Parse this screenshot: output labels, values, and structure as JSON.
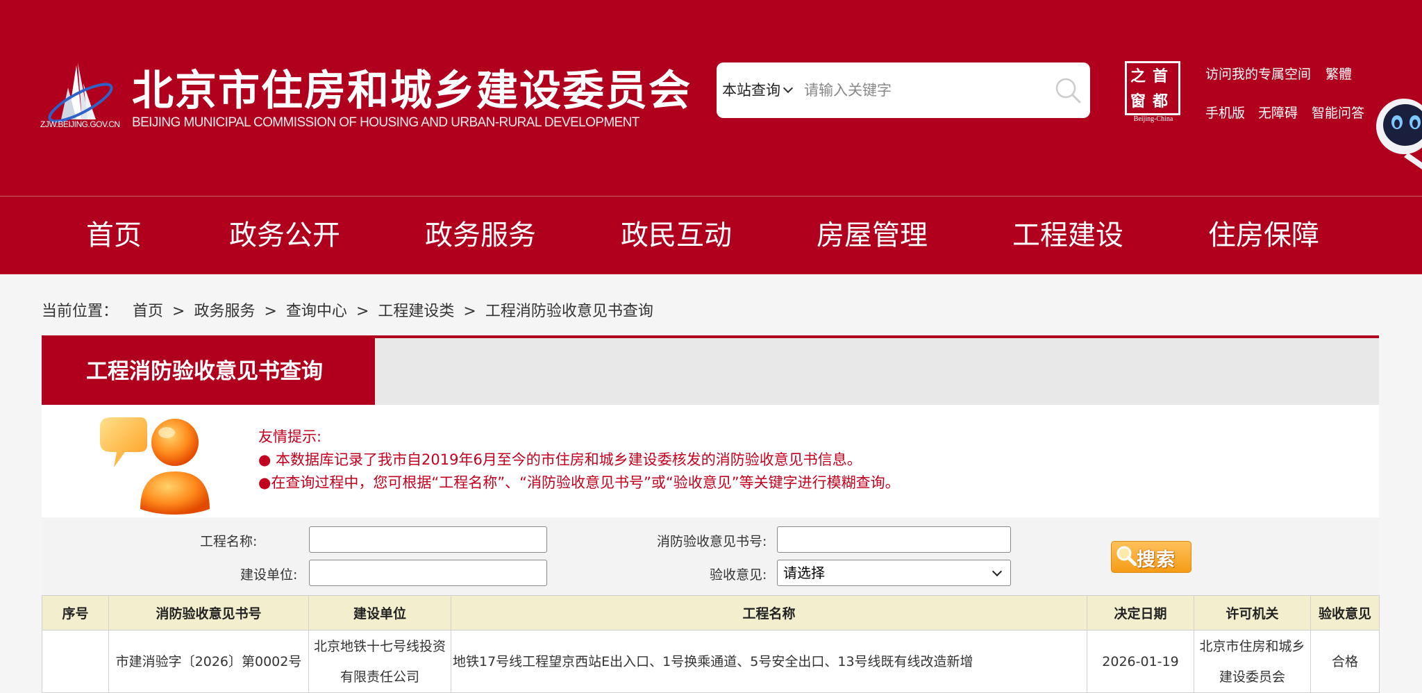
{
  "header": {
    "site_title": "北京市住房和城乡建设委员会",
    "site_subtitle": "BEIJING MUNICIPAL COMMISSION OF HOUSING AND URBAN-RURAL DEVELOPMENT",
    "logo_url_text": "ZJW.BEIJING.GOV.CN",
    "search": {
      "scope": "本站查询",
      "placeholder": "请输入关键字"
    },
    "capital_window": {
      "chars": [
        "首",
        "之",
        "都",
        "窗"
      ],
      "en": "Beijing-China"
    },
    "links": {
      "my_space": "访问我的专属空间",
      "traditional": "繁體",
      "mobile": "手机版",
      "accessibility": "无障碍",
      "smart_qa": "智能问答"
    }
  },
  "nav": {
    "items": [
      "首页",
      "政务公开",
      "政务服务",
      "政民互动",
      "房屋管理",
      "工程建设",
      "住房保障"
    ]
  },
  "breadcrumb": {
    "label": "当前位置：",
    "items": [
      "首页",
      "政务服务",
      "查询中心",
      "工程建设类",
      "工程消防验收意见书查询"
    ],
    "separator": ">"
  },
  "panel": {
    "title": "工程消防验收意见书查询"
  },
  "tips": {
    "heading": "友情提示:",
    "line1": "● 本数据库记录了我市自2019年6月至今的市住房和城乡建设委核发的消防验收意见书信息。",
    "line2": "●在查询过程中，您可根据“工程名称”、“消防验收意见书号”或“验收意见”等关键字进行模糊查询。"
  },
  "form": {
    "project_name_label": "工程名称:",
    "opinion_no_label": "消防验收意见书号:",
    "builder_label": "建设单位:",
    "opinion_label": "验收意见:",
    "opinion_selected": "请选择",
    "search_button": "搜索"
  },
  "table": {
    "headers": [
      "序号",
      "消防验收意见书号",
      "建设单位",
      "工程名称",
      "决定日期",
      "许可机关",
      "验收意见"
    ],
    "rows": [
      {
        "seq": "",
        "opinion_no": "市建消验字〔2026〕第0002号",
        "builder": "北京地铁十七号线投资有限责任公司",
        "project": "地铁17号线工程望京西站E出入口、1号换乘通道、5号安全出口、13号线既有线改造新增",
        "date": "2026-01-19",
        "authority": "北京市住房和城乡建设委员会",
        "result": "合格"
      }
    ]
  },
  "colors": {
    "brand_red": "#b0001e",
    "tip_red": "#c3001e",
    "table_header_bg": "#f3efce",
    "search_button_orange": "#f59c16"
  }
}
